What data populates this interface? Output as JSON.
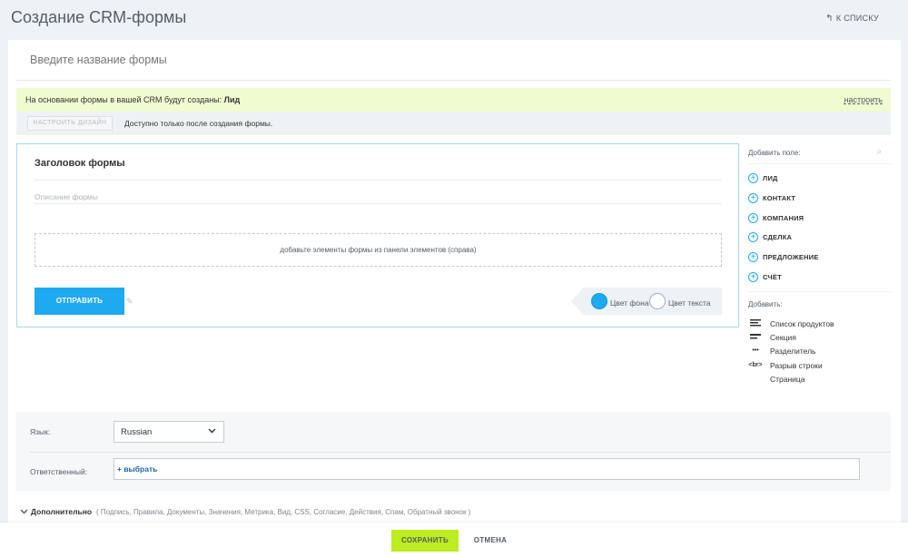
{
  "header": {
    "title": "Создание CRM-формы",
    "back_label": "К СПИСКУ"
  },
  "form_name": {
    "placeholder": "Введите название формы"
  },
  "notice": {
    "text": "На основании формы в вашей CRM будут созданы:",
    "entity": "Лид",
    "setup_link": "настроить"
  },
  "design": {
    "button_label": "НАСТРОИТЬ ДИЗАЙН",
    "note": "Доступно только после создания формы."
  },
  "form": {
    "heading": "Заголовок формы",
    "description_placeholder": "Описание формы",
    "dropzone_text": "добавьте элементы формы из панели элементов (справа)",
    "submit_label": "ОТПРАВИТЬ",
    "bg_color_label": "Цвет фона",
    "text_color_label": "Цвет текста",
    "colors": {
      "accent": "#1eaaf1",
      "save_green": "#bbed21"
    }
  },
  "sidebar": {
    "add_field_label": "Добавить поле:",
    "entities": [
      {
        "label": "ЛИД"
      },
      {
        "label": "КОНТАКТ"
      },
      {
        "label": "КОМПАНИЯ"
      },
      {
        "label": "СДЕЛКА"
      },
      {
        "label": "ПРЕДЛОЖЕНИЕ"
      },
      {
        "label": "СЧЁТ"
      }
    ],
    "add_label": "Добавить:",
    "add_items": [
      {
        "icon": "product-list-icon",
        "label": "Список продуктов"
      },
      {
        "icon": "section-icon",
        "label": "Секция"
      },
      {
        "icon": "divider-icon",
        "glyph": "•••",
        "label": "Разделитель"
      },
      {
        "icon": "line-break-icon",
        "glyph": "<br>",
        "label": "Разрыв строки"
      },
      {
        "icon": "page-icon",
        "label": "Страница"
      }
    ]
  },
  "settings": {
    "language_label": "Язык:",
    "language_value": "Russian",
    "responsible_label": "Ответственный:",
    "responsible_add": "+ выбрать"
  },
  "extra": {
    "label": "Дополнительно",
    "list": "( Подпись, Правила, Документы, Значения, Метрика, Вид, CSS, Согласие, Действия, Спам, Обратный звонок )"
  },
  "footer": {
    "save_label": "СОХРАНИТЬ",
    "cancel_label": "ОТМЕНА"
  }
}
